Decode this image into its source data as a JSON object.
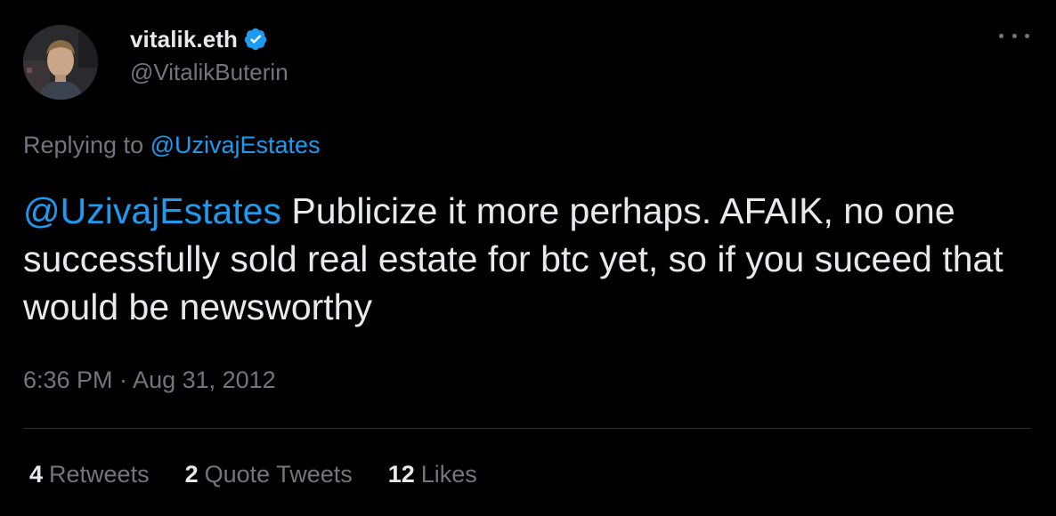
{
  "author": {
    "display_name": "vitalik.eth",
    "handle": "@VitalikButerin",
    "verified": true
  },
  "reply": {
    "prefix": "Replying to",
    "to": "@UzivajEstates"
  },
  "tweet": {
    "mention": "@UzivajEstates",
    "text": " Publicize it more perhaps. AFAIK, no one successfully sold real estate for btc yet, so if you suceed that would be newsworthy"
  },
  "timestamp": "6:36 PM · Aug 31, 2012",
  "stats": {
    "retweets": {
      "count": "4",
      "label": "Retweets"
    },
    "quotes": {
      "count": "2",
      "label": "Quote Tweets"
    },
    "likes": {
      "count": "12",
      "label": "Likes"
    }
  },
  "icons": {
    "verified": "verified-badge-icon",
    "more": "more-options-icon"
  },
  "colors": {
    "background": "#000000",
    "text_primary": "#e7e9ea",
    "text_secondary": "#71767b",
    "link": "#1d9bf0",
    "divider": "#2f3336"
  }
}
